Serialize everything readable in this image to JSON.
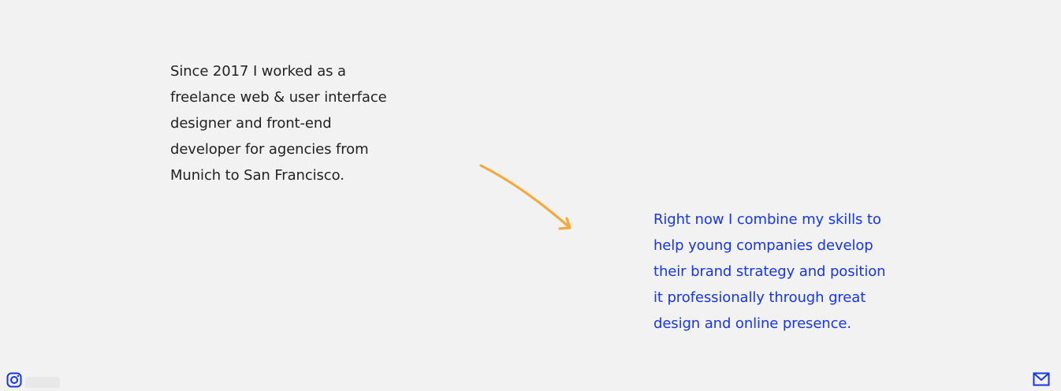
{
  "intro": {
    "lines": [
      "Since 2017 I worked as a",
      "freelance web & user interface",
      "designer and front-end",
      "developer for agencies from",
      "Munich to San Francisco."
    ]
  },
  "current": {
    "lines": [
      "Right now I combine my skills to",
      "help young companies develop",
      "their brand strategy and position",
      "it professionally through great",
      "design and online presence."
    ]
  },
  "icons": {
    "arrow": "arrow-icon",
    "instagram": "instagram-icon",
    "mail": "mail-icon"
  },
  "colors": {
    "background": "#f2f2f2",
    "text": "#222222",
    "accent_blue": "#1736e6",
    "arrow_orange": "#f5a93b"
  }
}
